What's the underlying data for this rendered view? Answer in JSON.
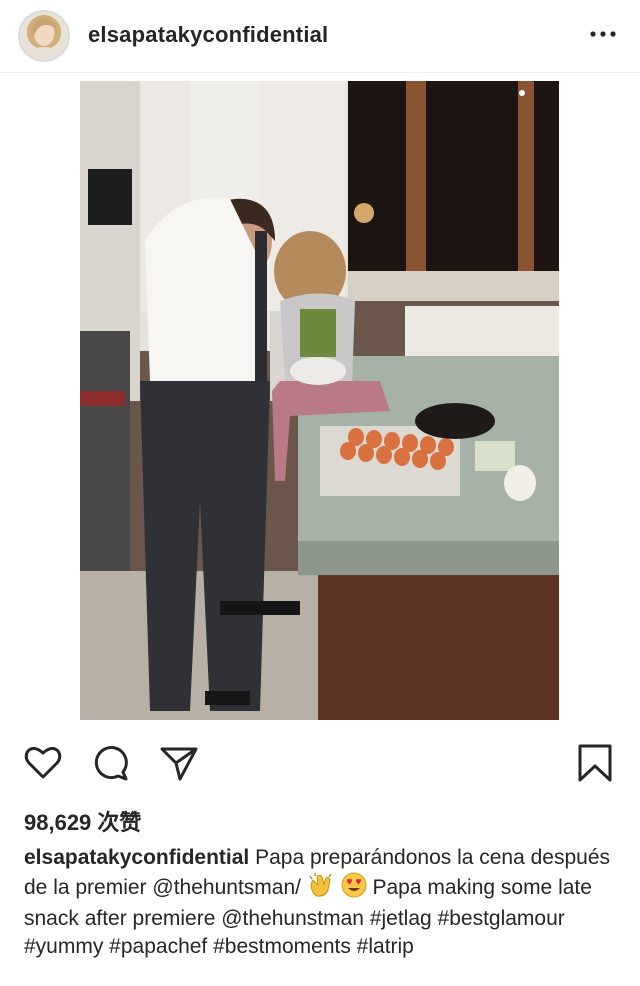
{
  "post": {
    "username": "elsapatakyconfidential",
    "more_icon": "more-dots-icon",
    "likes": "98,629 次赞",
    "caption": {
      "username": "elsapatakyconfidential",
      "text_part1": " Papa preparándonos la cena después de la premier @thehuntsman/ ",
      "emoji1": "clapping-hands-icon",
      "emoji2": "heart-eyes-icon",
      "text_part2": " Papa making some late snack after premiere @thehunstman  #jetlag #bestglamour #yummy #papachef #bestmoments #latrip"
    }
  },
  "actions": {
    "like_icon": "heart-icon",
    "comment_icon": "comment-icon",
    "share_icon": "paper-plane-icon",
    "save_icon": "bookmark-icon"
  }
}
